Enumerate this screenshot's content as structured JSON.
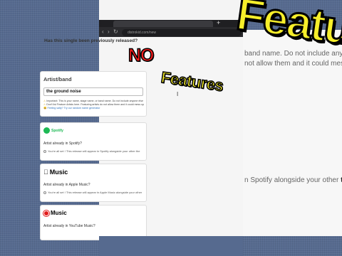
{
  "browser": {
    "new_tab_symbol": "+",
    "url": "distrokid.com/new"
  },
  "form": {
    "question": "Has this single been previously released?",
    "artist_label": "Artist/band",
    "artist_value": "the ground noise",
    "notes": [
      "Important: This is your name, stage name, or band name. Do not include anyone else",
      "Don't list Feature Artists here. Featuring artists do not allow them and it could mess up",
      "Feeling salty? Try our random name generator"
    ]
  },
  "stores": [
    {
      "name": "Spotify",
      "question": "Artist already in Spotify?",
      "option": "You're all set ! This release will appear in Spotify alongside your other the"
    },
    {
      "name": "Music",
      "question": "Artist already in Apple Music?",
      "option": "You're all set ! This release will appear in Apple Music alongside your other"
    },
    {
      "name": "Music",
      "question": "Artist already in YouTube Music?",
      "option": ""
    }
  ],
  "bleed": {
    "line1": "band name. Do not include anyone els",
    "line2": "not allow them and it could mess up y",
    "line3_prefix": "n Spotify alongside your other ",
    "line3_bold": "the"
  },
  "overlays": {
    "no": "NO",
    "features_small": "Features",
    "features_big": "Features"
  },
  "colors": {
    "spotify": "#1db954",
    "youtube": "#e11b1b",
    "overlay_red": "#ff1c1c",
    "overlay_yellow": "#f7ef2a"
  }
}
